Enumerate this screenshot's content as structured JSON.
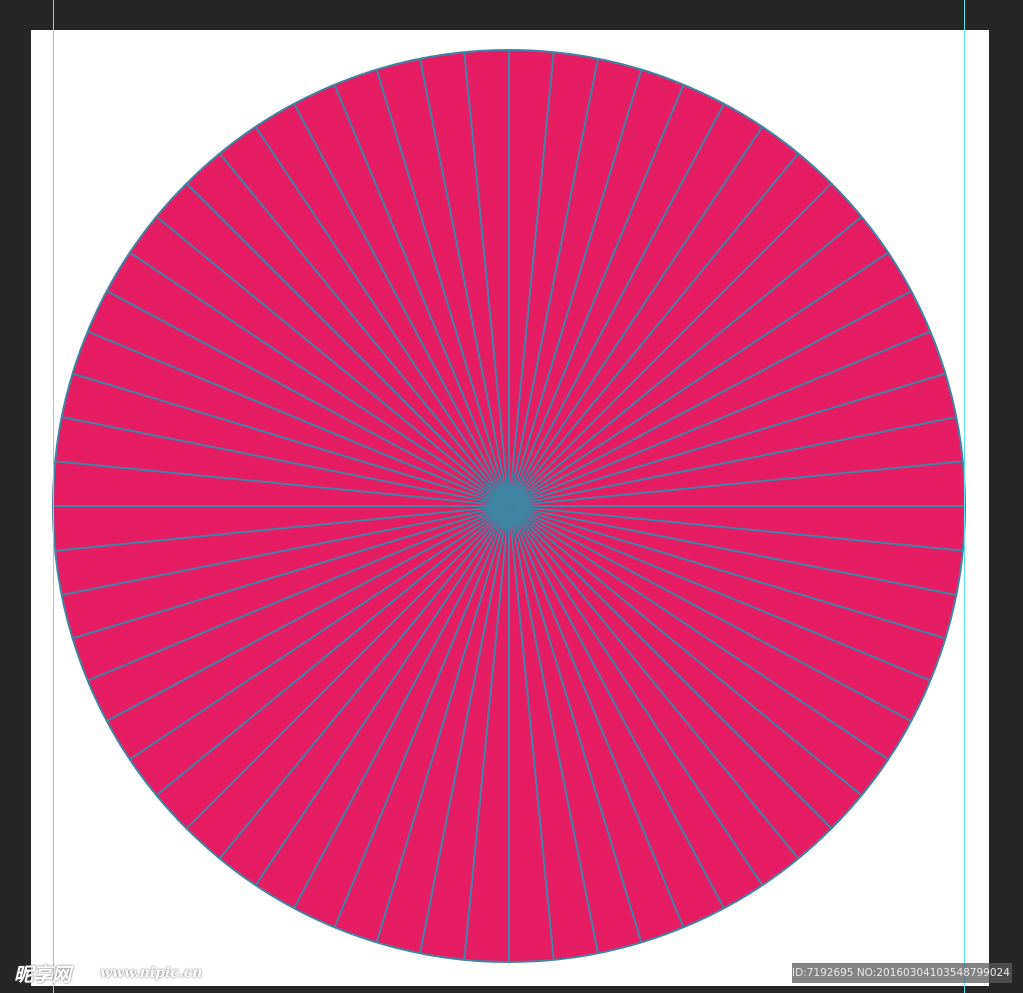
{
  "canvas": {
    "background_color": "#262626",
    "artboard_color": "#ffffff",
    "guide_color": "#5fe3ee"
  },
  "artwork": {
    "shape": "circle",
    "fill_color": "#e61d63",
    "stroke_color": "#3f84a3",
    "ray_count": 64
  },
  "watermark": {
    "logo_text": "昵享网",
    "site_text": "www.nipic.cn",
    "id_text": "ID:7192695 NO:20160304103548799024"
  }
}
